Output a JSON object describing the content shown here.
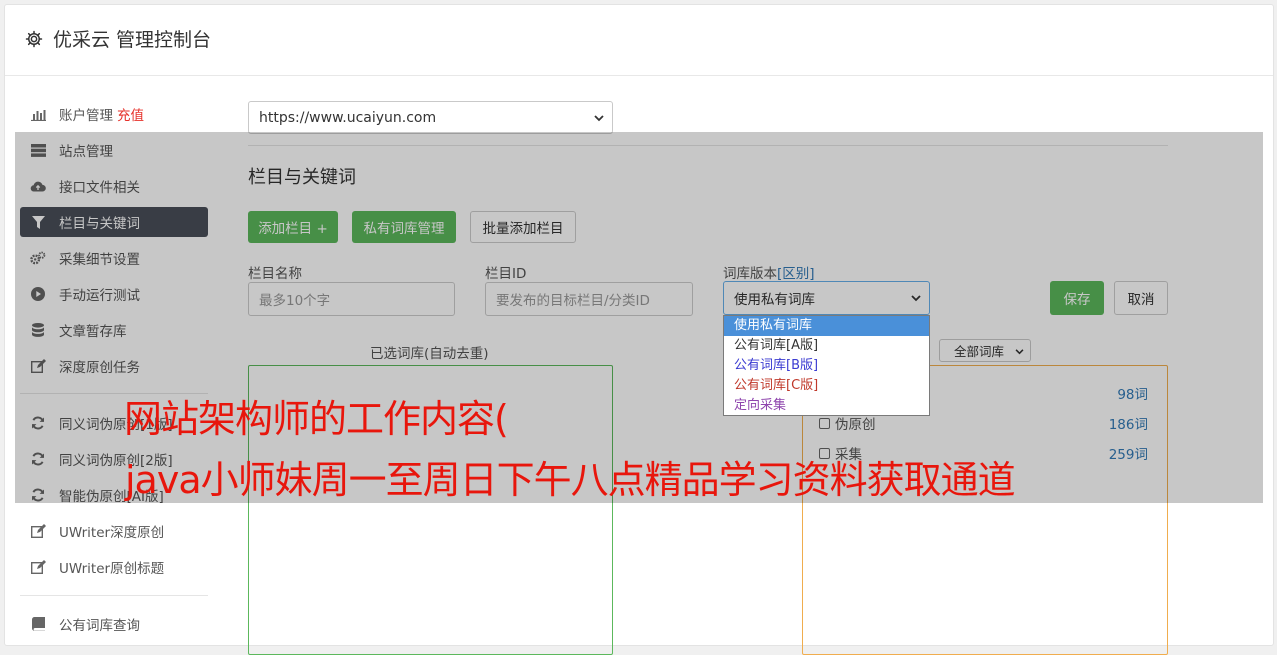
{
  "header": {
    "title": "优采云 管理控制台"
  },
  "sidebar": {
    "items": [
      {
        "label": "账户管理",
        "icon": "bar-chart-icon"
      },
      {
        "label": "站点管理",
        "icon": "server-icon"
      },
      {
        "label": "接口文件相关",
        "icon": "cloud-upload-icon"
      },
      {
        "label": "栏目与关键词",
        "icon": "filter-icon"
      },
      {
        "label": "采集细节设置",
        "icon": "gears-icon"
      },
      {
        "label": "手动运行测试",
        "icon": "play-circle-icon"
      },
      {
        "label": "文章暂存库",
        "icon": "database-icon"
      },
      {
        "label": "深度原创任务",
        "icon": "edit-icon"
      },
      {
        "label": "同义词伪原创[1版]",
        "icon": "refresh-icon"
      },
      {
        "label": "同义词伪原创[2版]",
        "icon": "refresh-icon"
      },
      {
        "label": "智能伪原创[AI版]",
        "icon": "refresh-icon"
      },
      {
        "label": "UWriter深度原创",
        "icon": "edit-icon"
      },
      {
        "label": "UWriter原创标题",
        "icon": "edit-icon"
      },
      {
        "label": "公有词库查询",
        "icon": "book-icon"
      }
    ],
    "recharge": "充值"
  },
  "site_select": {
    "value": "https://www.ucaiyun.com"
  },
  "section": {
    "title": "栏目与关键词",
    "buttons": {
      "add_column": "添加栏目 +",
      "private_lib": "私有词库管理",
      "batch_add": "批量添加栏目"
    }
  },
  "form": {
    "column_name": {
      "label": "栏目名称",
      "placeholder": "最多10个字"
    },
    "column_id": {
      "label": "栏目ID",
      "placeholder": "要发布的目标栏目/分类ID"
    },
    "lib_version": {
      "label": "词库版本",
      "diff_link": "[区别]",
      "value": "使用私有词库"
    },
    "save": "保存",
    "cancel": "取消"
  },
  "dropdown": {
    "options": [
      {
        "label": "使用私有词库",
        "color": "#ffffff"
      },
      {
        "label": "公有词库[A版]",
        "color": "#333333"
      },
      {
        "label": "公有词库[B版]",
        "color": "#3b3bd1"
      },
      {
        "label": "公有词库[C版]",
        "color": "#c0392b"
      },
      {
        "label": "定向采集",
        "color": "#8e44ad"
      }
    ]
  },
  "selected_libs": {
    "title": "已选词库(自动去重)"
  },
  "all_libs": {
    "filter": "全部词库",
    "rows": [
      {
        "label": "",
        "count": "98词"
      },
      {
        "label": "伪原创",
        "count": "186词"
      },
      {
        "label": "采集",
        "count": "259词"
      }
    ]
  },
  "watermark": {
    "line1": "网站架构师的工作内容(",
    "line2": "java小师妹周一至周日下午八点精品学习资料获取通道"
  },
  "colors": {
    "active_nav": "#4a4f59",
    "green": "#5cb85c",
    "link": "#337ab7",
    "watermark": "#e8160c"
  }
}
